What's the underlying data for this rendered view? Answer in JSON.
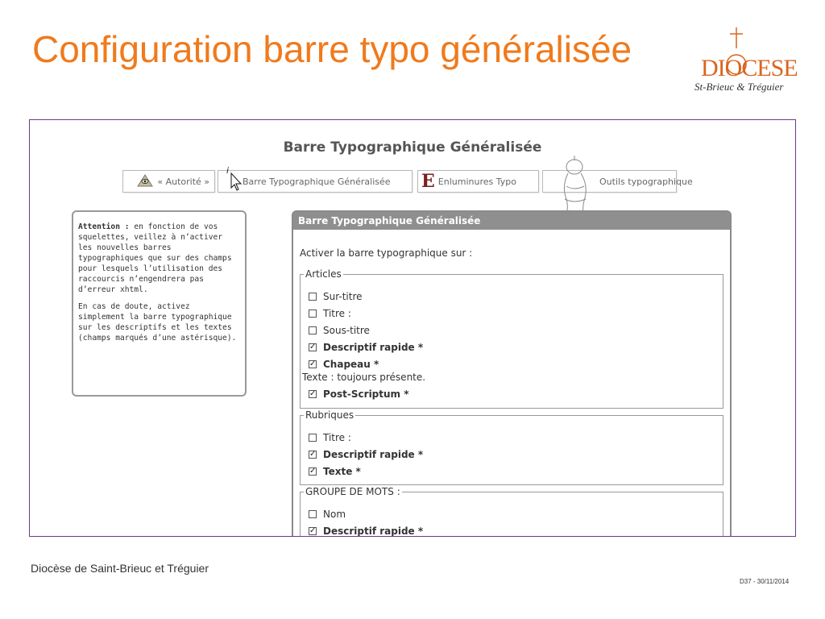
{
  "slide": {
    "title": "Configuration barre typo généralisée",
    "footer_left": "Diocèse de Saint-Brieuc et Tréguier",
    "footer_right": "D37 - 30/11/2014"
  },
  "logo": {
    "line1": "DIOCESE",
    "line2": "St-Brieuc & Tréguier"
  },
  "page": {
    "heading": "Barre Typographique Généralisée",
    "tabs": [
      {
        "label": "« Autorité »",
        "icon": "eye-pyramid-icon"
      },
      {
        "label": "Barre Typographique Généralisée",
        "icon": "cursor-icon"
      },
      {
        "label": "Enluminures Typo",
        "icon": "illuminated-e-icon"
      },
      {
        "label": "Outils typographique",
        "icon": "knight-icon"
      }
    ],
    "note": {
      "p1_bold": "Attention :",
      "p1_rest": " en fonction de vos squelettes, veillez à n’activer les nouvelles barres typographiques que sur des champs pour lesquels l’utilisation des raccourcis n’engendrera pas d’erreur xhtml.",
      "p2": "En cas de doute, activez simplement la barre typographique sur les descriptifs et les textes (champs marqués d’une astérisque)."
    },
    "panel": {
      "header": "Barre Typographique Généralisée",
      "intro": "Activer la barre typographique sur :",
      "groups": [
        {
          "legend": "Articles",
          "options": [
            {
              "label": "Sur-titre",
              "checked": false
            },
            {
              "label": "Titre :",
              "checked": false
            },
            {
              "label": "Sous-titre",
              "checked": false
            },
            {
              "label": "Descriptif rapide *",
              "checked": true
            },
            {
              "label": "Chapeau *",
              "checked": true
            },
            {
              "label": "Post-Scriptum *",
              "checked": true
            }
          ],
          "note": "Texte : toujours présente."
        },
        {
          "legend": "Rubriques",
          "options": [
            {
              "label": "Titre :",
              "checked": false
            },
            {
              "label": "Descriptif rapide *",
              "checked": true
            },
            {
              "label": "Texte *",
              "checked": true
            }
          ]
        },
        {
          "legend": "GROUPE DE MOTS :",
          "options": [
            {
              "label": "Nom",
              "checked": false
            },
            {
              "label": "Descriptif rapide *",
              "checked": true
            }
          ]
        }
      ]
    }
  },
  "colors": {
    "title": "#f07a1c",
    "frame_border": "#6a3b85",
    "panel_header": "#8f8f8f"
  }
}
